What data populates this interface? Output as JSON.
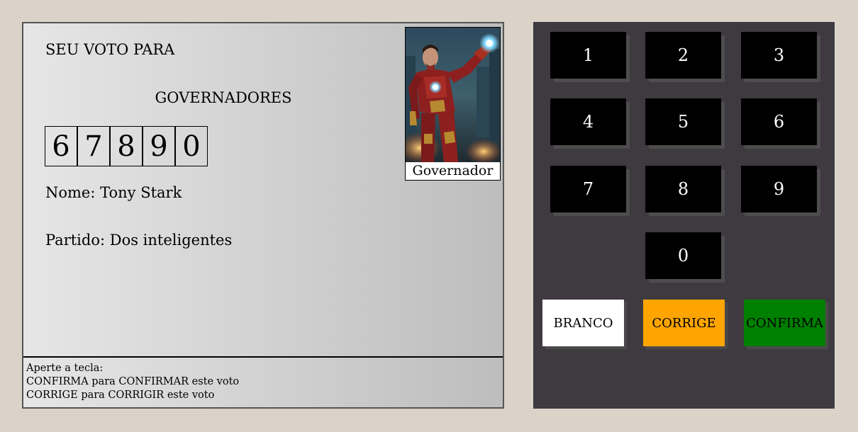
{
  "screen": {
    "title": "SEU VOTO PARA",
    "office": "GOVERNADORES",
    "digits": [
      "6",
      "7",
      "8",
      "9",
      "0"
    ],
    "name": "Nome: Tony Stark",
    "party": "Partido: Dos inteligentes",
    "photo_caption": "Governador",
    "instructions": {
      "line1": "Aperte a tecla:",
      "line2": "CONFIRMA para CONFIRMAR este voto",
      "line3": "CORRIGE para CORRIGIR este voto"
    }
  },
  "keypad": {
    "keys": [
      "1",
      "2",
      "3",
      "4",
      "5",
      "6",
      "7",
      "8",
      "9",
      "0"
    ],
    "branco": "BRANCO",
    "corrige": "CORRIGE",
    "confirma": "CONFIRMA"
  },
  "colors": {
    "background": "#dbd3c8",
    "keypad": "#3e3a40",
    "branco": "#ffffff",
    "corrige": "#ffa500",
    "confirma": "#008000"
  }
}
